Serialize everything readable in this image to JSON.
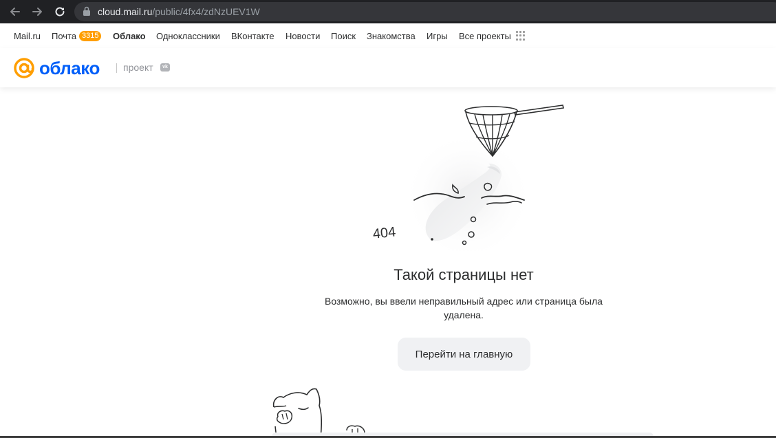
{
  "browser": {
    "url_domain": "cloud.mail.ru",
    "url_path": "/public/4fx4/zdNzUEV1W",
    "icons": [
      "back-arrow-icon",
      "forward-arrow-icon",
      "reload-icon",
      "lock-icon"
    ]
  },
  "portal_nav": {
    "items": [
      {
        "label": "Mail.ru"
      },
      {
        "label": "Почта",
        "badge": "3315"
      },
      {
        "label": "Облако",
        "active": true
      },
      {
        "label": "Одноклассники"
      },
      {
        "label": "ВКонтакте"
      },
      {
        "label": "Новости"
      },
      {
        "label": "Поиск"
      },
      {
        "label": "Знакомства"
      },
      {
        "label": "Игры"
      },
      {
        "label": "Все проекты"
      }
    ],
    "apps_icon": "apps-grid-icon"
  },
  "header": {
    "logo_text": "облако",
    "project_label": "проект",
    "vk_mark": "vk"
  },
  "error": {
    "code": "404",
    "title": "Такой страницы нет",
    "description": "Возможно, вы ввели неправильный адрес или страница была удалена.",
    "button_label": "Перейти на главную"
  },
  "colors": {
    "brand_blue": "#005ff9",
    "logo_orange": "#ff9e00",
    "badge_orange": "#ff9e00",
    "button_bg": "#f0f1f3",
    "chrome_bg": "#202124"
  }
}
